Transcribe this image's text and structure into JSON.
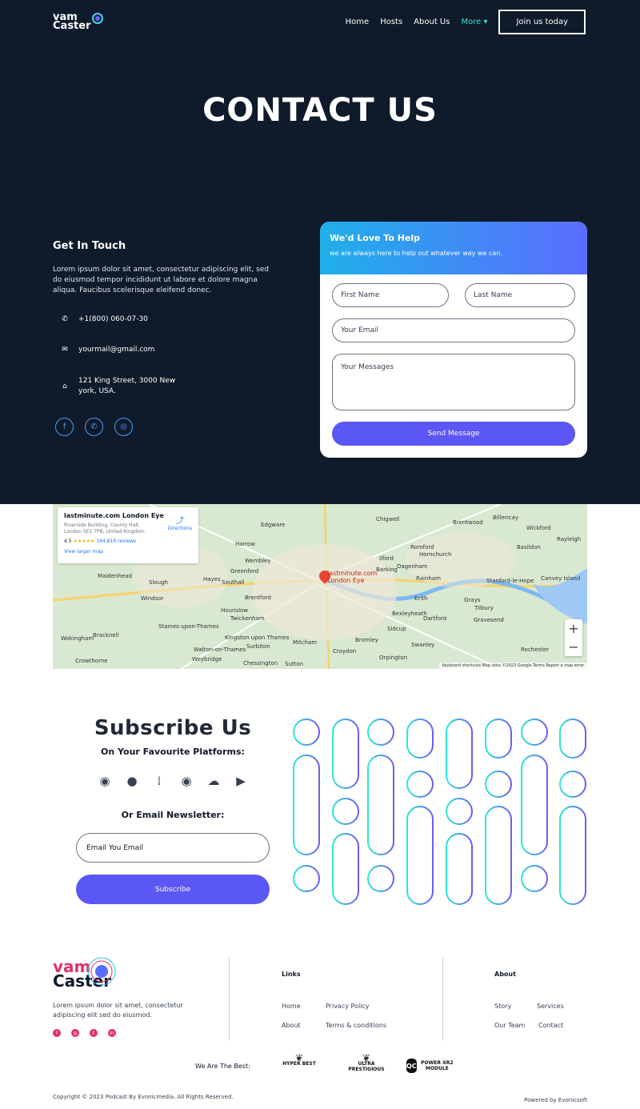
{
  "nav": {
    "logo_line1": "vam",
    "logo_line2": "Caster",
    "links": [
      "Home",
      "Hosts",
      "About Us",
      "More"
    ],
    "join_label": "Join us today",
    "accent_color": "#2ee6d6"
  },
  "hero": {
    "title": "CONTACT US"
  },
  "get_in_touch": {
    "heading": "Get In Touch",
    "text": "Lorem ipsum dolor sit amet, consectetur adipiscing elit, sed do eiusmod tempor incididunt ut labore et dolore magna aliqua. Faucibus scelerisque eleifend donec.",
    "phone": "+1(800) 060-07-30",
    "email": "yourmail@gmail.com",
    "address_line1": "121 King Street, 3000 New",
    "address_line2": "york, USA."
  },
  "form": {
    "title": "We'd Love To Help",
    "subtitle": "we are always here to help out whatever way we can.",
    "first_name": "First Name",
    "last_name": "Last Name",
    "email": "Your Email",
    "messages": "Your Messages",
    "send_label": "Send Message"
  },
  "map": {
    "place": "lastminute.com London Eye",
    "address_line1": "Riverside Building, County Hall,",
    "address_line2": "London SE1 7PB, United Kingdom",
    "rating": "4.5",
    "reviews": "164,819 reviews",
    "larger": "View larger map",
    "directions": "Directions",
    "pin_label1": "lastminute.com",
    "pin_label2": "London Eye",
    "footer": "Keyboard shortcuts   Map data ©2023 Google   Terms   Report a map error",
    "labels": [
      "Edgware",
      "Harrow",
      "Wembley",
      "Slough",
      "Hounslow",
      "Twickenham",
      "Croydon",
      "Bromley",
      "Romford",
      "Ilford",
      "Dartford",
      "Gravesend",
      "Brentwood",
      "Basildon",
      "Hornchurch",
      "Barking",
      "Sutton",
      "Mitcham",
      "Kingston upon Thames",
      "Windsor",
      "Maidenhead",
      "Bracknell",
      "Wokingham",
      "Weybridge",
      "Sidcup",
      "Swanley",
      "Rainham",
      "Grays",
      "Tilbury",
      "Chigwell",
      "Greenford",
      "Southall",
      "Hayes",
      "Brentford",
      "Dagenham",
      "Orpington",
      "Erith",
      "Bexleyheath",
      "Rochester",
      "Wickford",
      "Billericay",
      "Canvey Island",
      "Stanford-le-Hope",
      "Chessington",
      "Surbiton",
      "Staines-upon-Thames",
      "Walton-on-Thames",
      "Crowthorne",
      "Rayleigh"
    ]
  },
  "subscribe": {
    "title": "Subscribe Us",
    "favourite": "On Your Favourite Platforms:",
    "newsletter": "Or Email Newsletter:",
    "email_placeholder": "Email You Email",
    "button": "Subscribe",
    "platforms": [
      "spotify-icon",
      "apple-icon",
      "google-podcasts-icon",
      "spotify-icon",
      "soundcloud-icon",
      "youtube-icon"
    ]
  },
  "footer": {
    "logo_line1": "vam",
    "logo_line2": "Caster",
    "desc": "Lorem ipsum dolor sit amet, consectetur adipiscing elit  sed do eiusmod.",
    "links_title": "Links",
    "links": [
      "Home",
      "Privacy Policy",
      "About",
      "Terms & conditions"
    ],
    "about_title": "About",
    "about_links": [
      "Story",
      "Services",
      "Our Team",
      "Contact"
    ],
    "best_label": "We Are The Best:",
    "badges": [
      "HYPER BEST",
      "ULTRA PRESTIGIOUS",
      "POWER XR2 MODULE"
    ],
    "copyright": "Copyright © 2023 Podcast By Evonicmedia. All Rights Reserved.",
    "powered": "Powered by Evonicsoft"
  }
}
